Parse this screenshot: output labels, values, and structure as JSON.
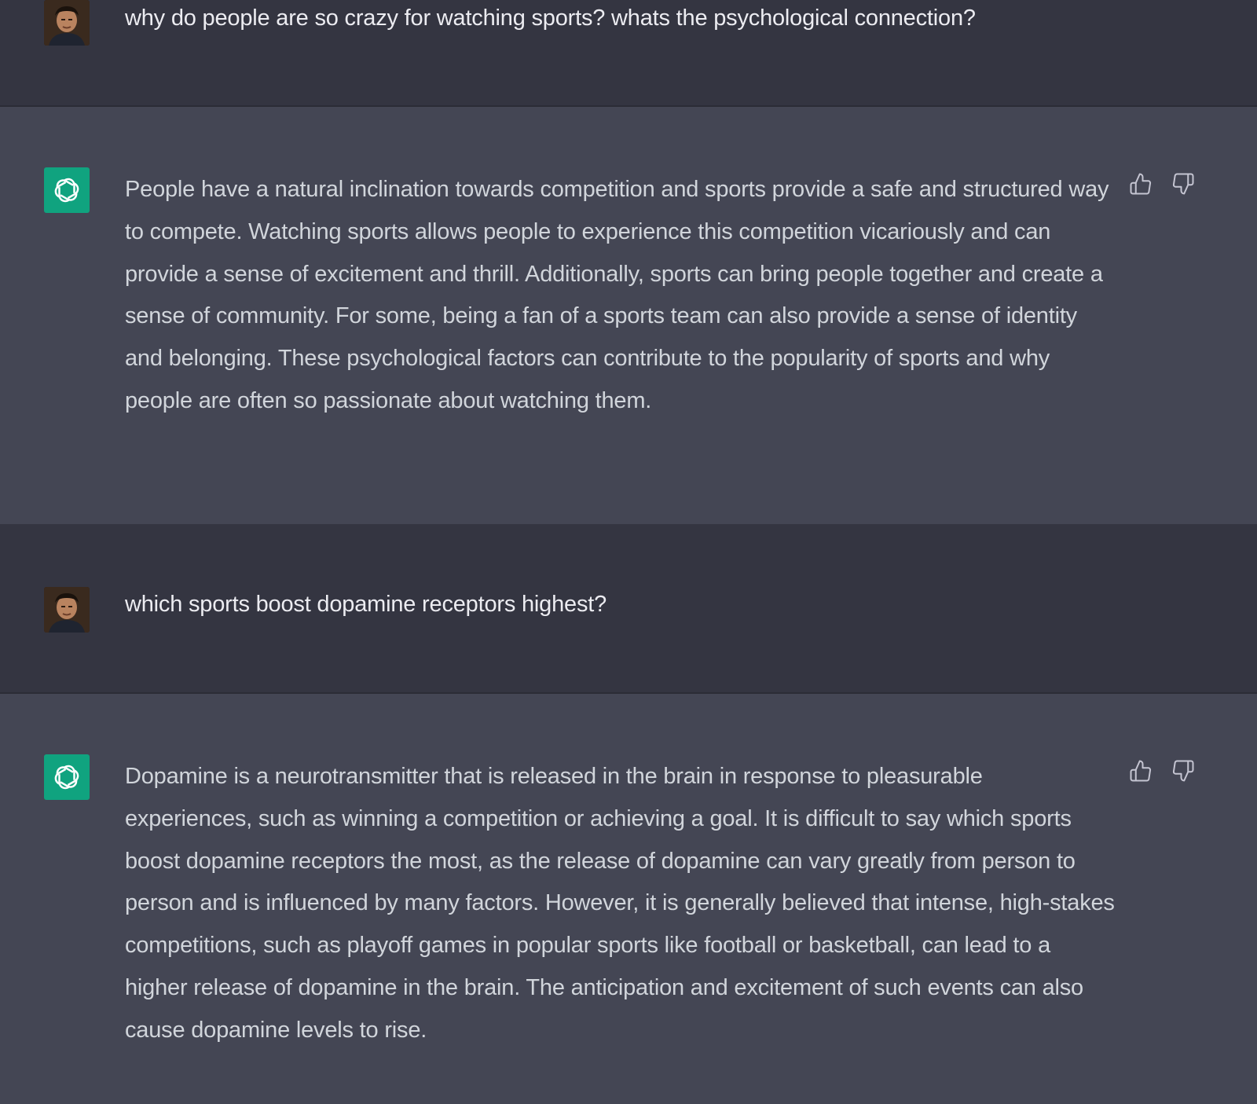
{
  "conversation": [
    {
      "role": "user",
      "text": "why do people are so crazy for watching sports? whats the psychological connection?"
    },
    {
      "role": "assistant",
      "text": "People have a natural inclination towards competition and sports provide a safe and structured way to compete. Watching sports allows people to experience this competition vicariously and can provide a sense of excitement and thrill. Additionally, sports can bring people together and create a sense of community. For some, being a fan of a sports team can also provide a sense of identity and belonging. These psychological factors can contribute to the popularity of sports and why people are often so passionate about watching them."
    },
    {
      "role": "user",
      "text": "which sports boost dopamine receptors highest?"
    },
    {
      "role": "assistant",
      "text": "Dopamine is a neurotransmitter that is released in the brain in response to pleasurable experiences, such as winning a competition or achieving a goal. It is difficult to say which sports boost dopamine receptors the most, as the release of dopamine can vary greatly from person to person and is influenced by many factors. However, it is generally believed that intense, high-stakes competitions, such as playoff games in popular sports like football or basketball, can lead to a higher release of dopamine in the brain. The anticipation and excitement of such events can also cause dopamine levels to rise."
    }
  ],
  "icons": {
    "user_avatar": "user-avatar-photo",
    "assistant_avatar": "openai-logo-icon",
    "like": "thumbs-up-icon",
    "dislike": "thumbs-down-icon"
  },
  "colors": {
    "user_row_bg": "#343541",
    "assistant_row_bg": "#444654",
    "assistant_avatar_bg": "#10a37f",
    "text": "#ececf1"
  }
}
